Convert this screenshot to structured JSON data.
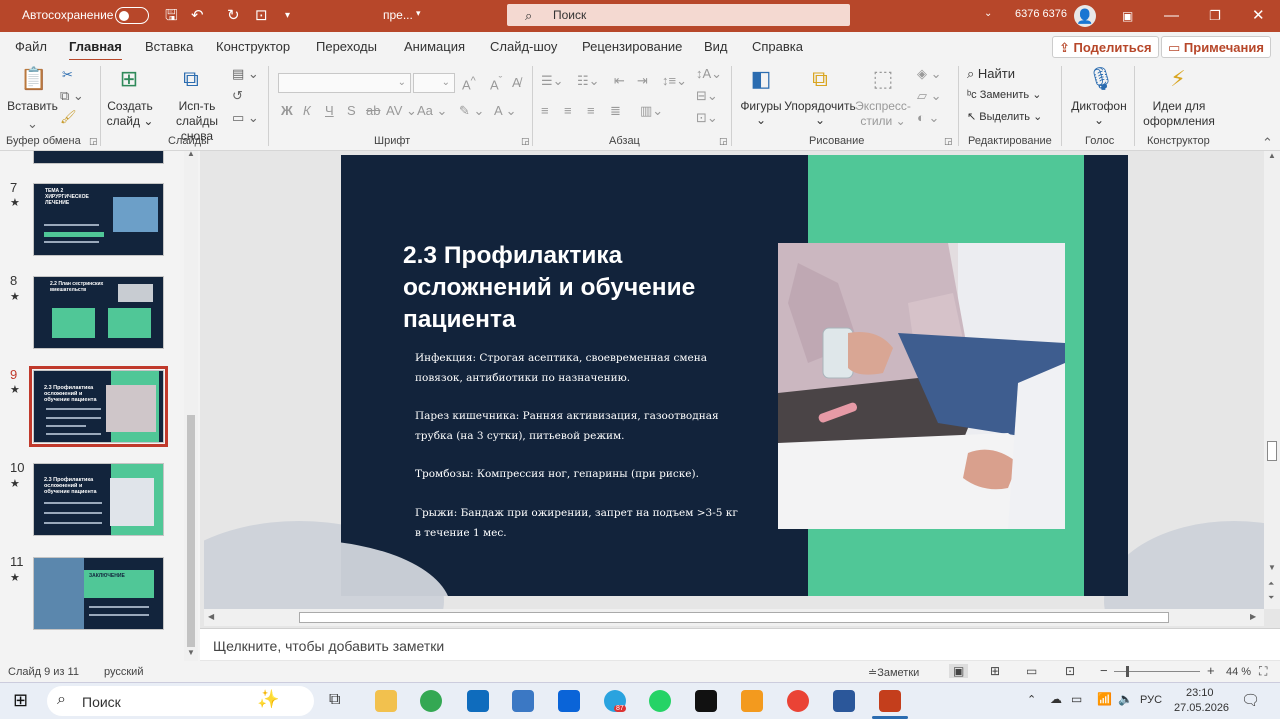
{
  "titlebar": {
    "autosave_label": "Автосохранение",
    "doc_title": "пре...",
    "search_placeholder": "Поиск",
    "user_name": "6376 6376",
    "accent": "#b7472a"
  },
  "menu": {
    "items": [
      "Файл",
      "Главная",
      "Вставка",
      "Конструктор",
      "Переходы",
      "Анимация",
      "Слайд-шоу",
      "Рецензирование",
      "Вид",
      "Справка"
    ],
    "share": "Поделиться",
    "comments": "Примечания"
  },
  "ribbon": {
    "paste": "Вставить",
    "new_slide": [
      "Создать",
      "слайд"
    ],
    "reuse": [
      "Исп-ть",
      "слайды снова"
    ],
    "shapes": "Фигуры",
    "arrange": "Упорядочить",
    "quick_styles": [
      "Экспресс-",
      "стили"
    ],
    "find": "Найти",
    "replace": "Заменить",
    "select": "Выделить",
    "dictation": "Диктофон",
    "designer": [
      "Идеи для",
      "оформления"
    ],
    "font_bold": "Ж",
    "font_italic": "К",
    "font_underline": "Ч",
    "groups": [
      "Буфер обмена",
      "Слайды",
      "Шрифт",
      "Абзац",
      "Рисование",
      "Редактирование",
      "Голос",
      "Конструктор"
    ]
  },
  "thumbnails": [
    {
      "num": "7",
      "title": "ТЕМА 2 ХИРУРГИЧЕСКОЕ ЛЕЧЕНИЕ"
    },
    {
      "num": "8",
      "title": "2.2 План сестринских вмешательств"
    },
    {
      "num": "9",
      "title": "2.3 Профилактика осложнений и обучение пациента"
    },
    {
      "num": "10",
      "title": "2.3 Профилактика осложнений и обучение пациента"
    },
    {
      "num": "11",
      "title": "ЗАКЛЮЧЕНИЕ"
    }
  ],
  "slide": {
    "title": "2.3 Профилактика осложнений и обучение пациента",
    "bullets": [
      "Инфекция: Строгая асептика, своевременная смена повязок, антибиотики по назначению.",
      "Парез кишечника: Ранняя активизация, газоотводная трубка (на 3 сутки), питьевой режим.",
      "Тромбозы: Компрессия ног, гепарины (при риске).",
      "Грыжи: Бандаж при ожирении, запрет на подъем >3-5 кг в течение 1 мес."
    ],
    "bg_color": "#12233b",
    "green_color": "#50c797"
  },
  "notes": {
    "placeholder": "Щелкните, чтобы добавить заметки"
  },
  "status": {
    "slide_info": "Слайд 9 из 11",
    "language": "русский",
    "notes_btn": "Заметки",
    "zoom": "44 %"
  },
  "taskbar": {
    "search": "Поиск",
    "lang": "РУС",
    "time": "23:10",
    "date": "27.05.2026",
    "telegram_badge": "87"
  }
}
